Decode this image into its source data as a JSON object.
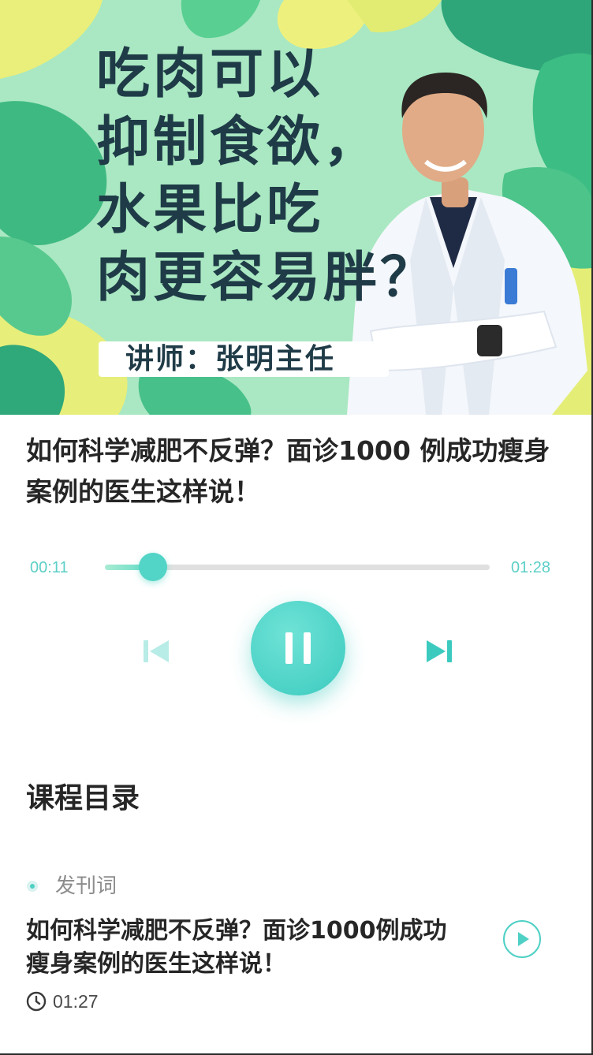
{
  "banner": {
    "headline_lines": [
      "吃肉可以",
      "抑制食欲，",
      "水果比吃",
      "肉更容易胖？"
    ],
    "lecturer": "讲师：张明主任",
    "background_color": "#a9e8c2",
    "headline_color": "#1f3b47"
  },
  "course": {
    "title": "如何科学减肥不反弹？面诊1000 例成功瘦身案例的医生这样说！"
  },
  "player": {
    "current_time": "00:11",
    "total_time": "01:28",
    "progress_percent": 12.5,
    "accent_color": "#52d4c6",
    "controls": {
      "previous": "skip-previous-icon",
      "pause": "pause-icon",
      "next": "skip-next-icon"
    }
  },
  "catalog": {
    "heading": "课程目录",
    "section_label": "发刊词",
    "lessons": [
      {
        "title": "如何科学减肥不反弹？面诊1000例成功瘦身案例的医生这样说！",
        "duration": "01:27"
      }
    ]
  }
}
